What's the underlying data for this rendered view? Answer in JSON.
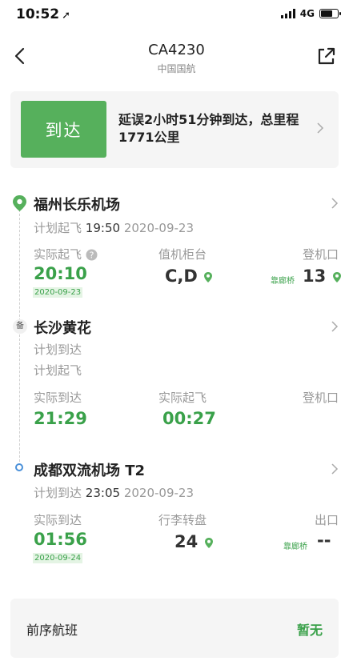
{
  "status_bar": {
    "time": "10:52",
    "network": "4G"
  },
  "nav": {
    "flight_no": "CA4230",
    "airline": "中国国航"
  },
  "status": {
    "state": "到达",
    "summary": "延误2小时51分钟到达，总里程1771公里"
  },
  "origin": {
    "name": "福州长乐机场",
    "plan_label": "计划起飞",
    "plan_time": "19:50",
    "plan_date": "2020-09-23",
    "actual_label": "实际起飞",
    "actual_time": "20:10",
    "actual_date": "2020-09-23",
    "counter_label": "值机柜台",
    "counter_value": "C,D",
    "gate_label": "登机口",
    "gate_note": "靠廊桥",
    "gate_value": "13"
  },
  "stopover": {
    "badge": "备",
    "name": "长沙黄花",
    "plan_arrive_label": "计划到达",
    "plan_depart_label": "计划起飞",
    "actual_arrive_label": "实际到达",
    "actual_arrive_time": "21:29",
    "actual_depart_label": "实际起飞",
    "actual_depart_time": "00:27",
    "gate_label": "登机口"
  },
  "destination": {
    "name": "成都双流机场 T2",
    "plan_label": "计划到达",
    "plan_time": "23:05",
    "plan_date": "2020-09-23",
    "actual_label": "实际到达",
    "actual_time": "01:56",
    "actual_date": "2020-09-24",
    "baggage_label": "行李转盘",
    "baggage_value": "24",
    "exit_label": "出口",
    "exit_note": "靠廊桥",
    "exit_value": "--"
  },
  "previous_flight": {
    "label": "前序航班",
    "value": "暂无"
  },
  "colors": {
    "accent_green": "#56b05c",
    "text_green": "#3aa14a",
    "origin_pin": "#56b05c",
    "destination_dot": "#4a90d9"
  }
}
